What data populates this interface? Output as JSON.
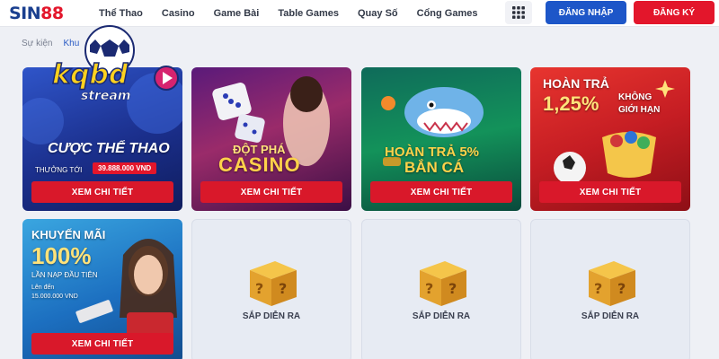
{
  "header": {
    "logo_text": "SIN",
    "logo_num": "88",
    "nav": [
      "Thể Thao",
      "Casino",
      "Game Bài",
      "Table Games",
      "Quay Số",
      "Cổng Games"
    ],
    "login_label": "ĐĂNG NHẬP",
    "register_label": "ĐĂNG KÝ"
  },
  "breadcrumb": {
    "parent": "Sự kiện",
    "current": "Khu"
  },
  "watermark": {
    "brand": "kqbd",
    "sub": "stream"
  },
  "cards": [
    {
      "line1": "CƯỢC THỂ THAO",
      "line2": "THƯỞNG TỚI",
      "amount": "39.888.000 VND",
      "button": "XEM CHI TIẾT"
    },
    {
      "line1": "ĐỘT PHÁ",
      "line2": "CASINO",
      "button": "XEM CHI TIẾT"
    },
    {
      "line1": "HOÀN TRẢ 5%",
      "line2": "BẮN CÁ",
      "button": "XEM CHI TIẾT"
    },
    {
      "line1": "HOÀN TRẢ",
      "line2": "1,25%",
      "line3": "KHÔNG",
      "line4": "GIỚI HẠN",
      "button": "XEM CHI TIẾT"
    },
    {
      "line1": "KHUYẾN MÃI",
      "line2": "100%",
      "line3": "LẦN NẠP ĐẦU TIÊN",
      "line4": "Lên đến",
      "line5": "15.000.000 VND",
      "button": "XEM CHI TIẾT"
    },
    {
      "soon": "SẮP DIỄN RA"
    },
    {
      "soon": "SẮP DIỄN RA"
    },
    {
      "soon": "SẮP DIỄN RA"
    }
  ],
  "colors": {
    "brand_blue": "#1d56c8",
    "brand_red": "#e3162b",
    "button_red": "#d9182a",
    "page_bg": "#eef0f5"
  }
}
